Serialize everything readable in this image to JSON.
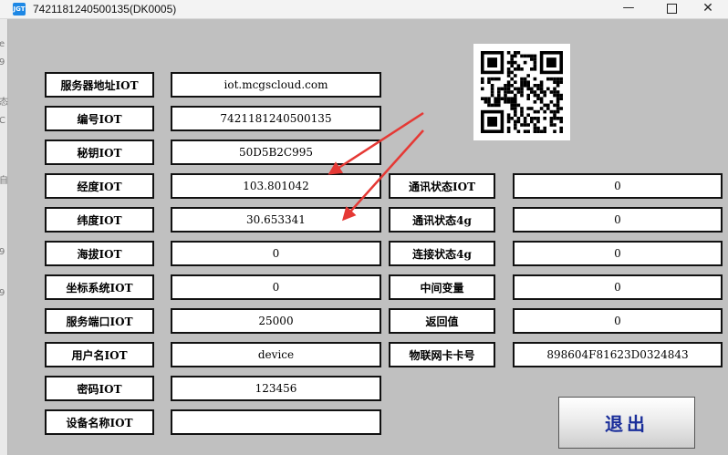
{
  "window": {
    "title": "7421181240500135(DK0005)",
    "icon_text": "JGT",
    "minimize_glyph": "—",
    "close_glyph": "✕"
  },
  "left_strip_chars": [
    "e",
    "9",
    "态",
    "C",
    "",
    "自",
    "9",
    "9"
  ],
  "rows": [
    {
      "label": "服务器地址IOT",
      "value": "iot.mcgscloud.com"
    },
    {
      "label": "编号IOT",
      "value": "7421181240500135"
    },
    {
      "label": "秘钥IOT",
      "value": "50D5B2C995"
    },
    {
      "label": "经度IOT",
      "value": "103.801042"
    },
    {
      "label": "纬度IOT",
      "value": "30.653341"
    },
    {
      "label": "海拔IOT",
      "value": "0"
    },
    {
      "label": "坐标系统IOT",
      "value": "0"
    },
    {
      "label": "服务端口IOT",
      "value": "25000"
    },
    {
      "label": "用户名IOT",
      "value": "device"
    },
    {
      "label": "密码IOT",
      "value": "123456"
    },
    {
      "label": "设备名称IOT",
      "value": ""
    }
  ],
  "status_rows": [
    {
      "label": "通讯状态IOT",
      "value": "0"
    },
    {
      "label": "通讯状态4g",
      "value": "0"
    },
    {
      "label": "连接状态4g",
      "value": "0"
    },
    {
      "label": "中间变量",
      "value": "0"
    },
    {
      "label": "返回值",
      "value": "0"
    },
    {
      "label": "物联网卡卡号",
      "value": "898604F81623D0324843"
    }
  ],
  "exit_label": "退出",
  "colors": {
    "background": "#c0c0c0",
    "arrow": "#e53935",
    "exit_text": "#1a2e9a"
  },
  "icons": {
    "app": "app-icon",
    "qr": "qr-code",
    "arrow": "red-arrow"
  }
}
